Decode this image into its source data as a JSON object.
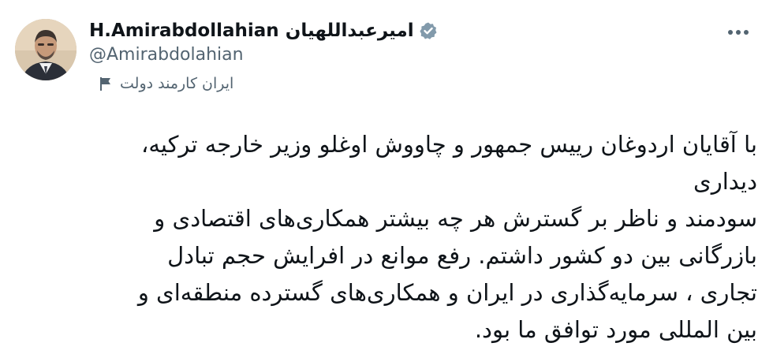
{
  "author": {
    "display_name": "H.Amirabdollahian امیرعبداللهیان",
    "handle": "@Amirabdolahian",
    "verified": true,
    "account_label": "ایران کارمند دولت"
  },
  "tweet": {
    "lines": [
      "با آقایان اردوغان رییس جمهور و چاووش اوغلو وزیر خارجه ترکیه،",
      "دیداری",
      "سودمند و ناظر بر گسترش هر چه بیشتر همکاری‌های اقتصادی و",
      "بازرگانی بین دو کشور داشتم. رفع موانع در افرایش حجم تبادل",
      "تجاری ، سرمایه‌گذاری در ایران و همکاری‌های گسترده منطقه‌ای و",
      "بین المللی مورد توافق ما بود."
    ]
  },
  "colors": {
    "verified_badge": "#829aab",
    "secondary_text": "#536471",
    "primary_text": "#0f1419"
  },
  "icons": {
    "more": "more-horizontal-icon",
    "verified": "verified-badge-icon",
    "label": "flag-icon"
  }
}
